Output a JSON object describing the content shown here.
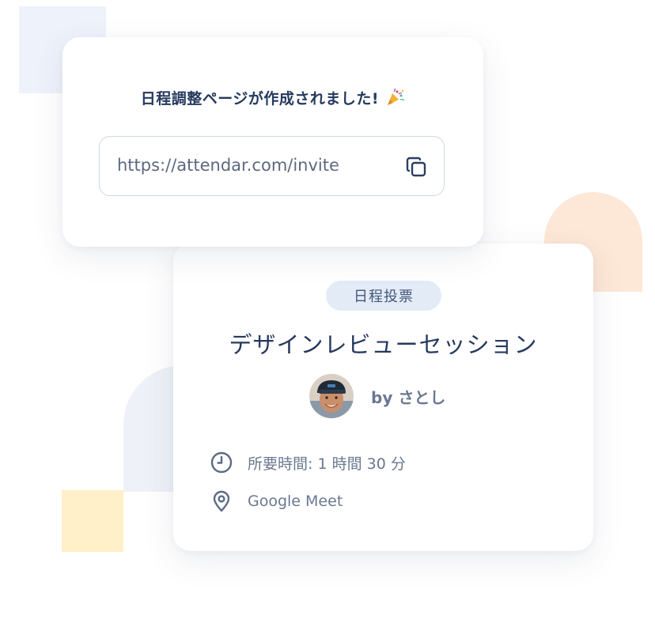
{
  "share": {
    "title": "日程調整ページが作成されました!",
    "title_icon": "party-popper-icon",
    "url": "https://attendar.com/invite",
    "copy_icon": "copy-icon"
  },
  "event": {
    "type_badge": "日程投票",
    "title": "デザインレビューセッション",
    "host": "by さとし",
    "duration": "所要時間: 1 時間 30 分",
    "location": "Google Meet"
  },
  "colors": {
    "accent_text": "#253a5e",
    "badge_bg": "#e3ebf7",
    "muted_text": "#6b7891"
  }
}
